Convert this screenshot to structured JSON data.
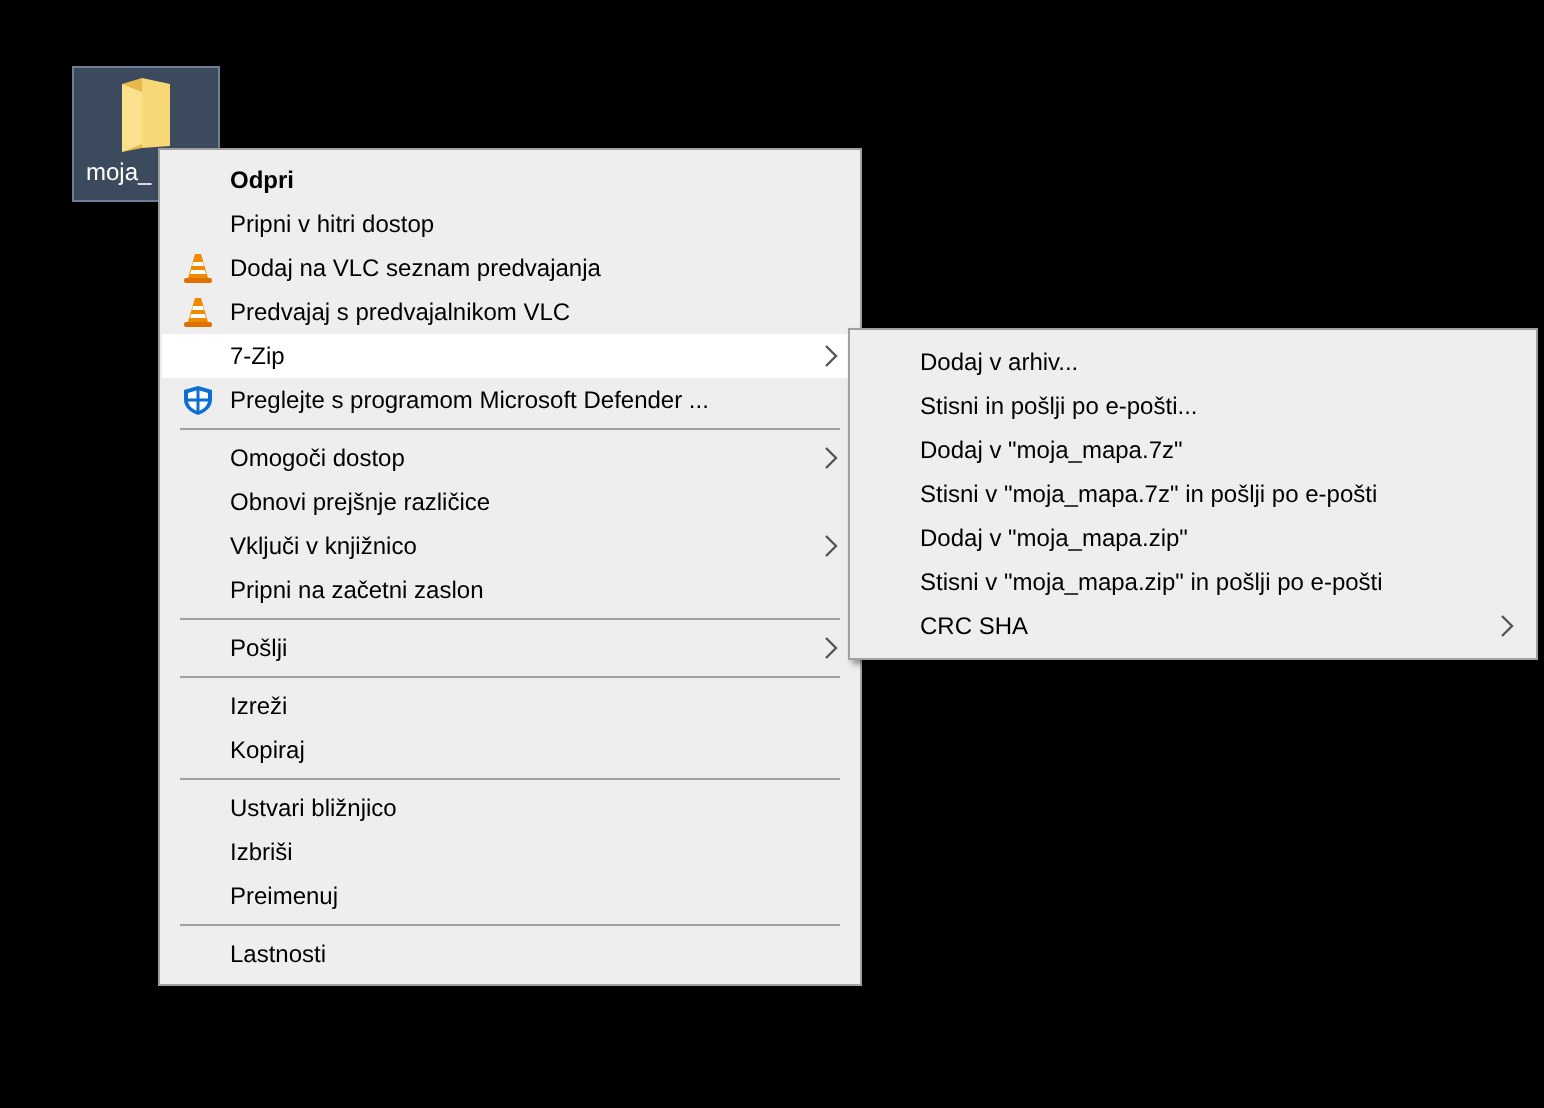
{
  "desktop_icon": {
    "label": "moja_",
    "selected": true
  },
  "context_menu": {
    "items": [
      {
        "kind": "default",
        "label": "Odpri",
        "selected": false
      },
      {
        "kind": "plain",
        "label": "Pripni v hitri dostop",
        "selected": false
      },
      {
        "kind": "vlc",
        "label": "Dodaj na VLC seznam predvajanja",
        "selected": false
      },
      {
        "kind": "vlc",
        "label": "Predvajaj s predvajalnikom VLC",
        "selected": false
      },
      {
        "kind": "submenu",
        "label": "7-Zip",
        "selected": true
      },
      {
        "kind": "defender",
        "label": "Preglejte s programom Microsoft Defender ...",
        "selected": false
      },
      {
        "kind": "separator"
      },
      {
        "kind": "submenu",
        "label": "Omogoči dostop",
        "selected": false
      },
      {
        "kind": "plain",
        "label": "Obnovi prejšnje različice",
        "selected": false
      },
      {
        "kind": "submenu",
        "label": "Vključi v knjižnico",
        "selected": false
      },
      {
        "kind": "plain",
        "label": "Pripni na začetni zaslon",
        "selected": false
      },
      {
        "kind": "separator"
      },
      {
        "kind": "submenu",
        "label": "Pošlji",
        "selected": false
      },
      {
        "kind": "separator"
      },
      {
        "kind": "plain",
        "label": "Izreži",
        "selected": false
      },
      {
        "kind": "plain",
        "label": "Kopiraj",
        "selected": false
      },
      {
        "kind": "separator"
      },
      {
        "kind": "plain",
        "label": "Ustvari bližnjico",
        "selected": false
      },
      {
        "kind": "plain",
        "label": "Izbriši",
        "selected": false
      },
      {
        "kind": "plain",
        "label": "Preimenuj",
        "selected": false
      },
      {
        "kind": "separator"
      },
      {
        "kind": "plain",
        "label": "Lastnosti",
        "selected": false
      }
    ]
  },
  "submenu": {
    "items": [
      {
        "kind": "plain",
        "label": "Dodaj v arhiv...",
        "selected": false
      },
      {
        "kind": "plain",
        "label": "Stisni in pošlji po e-pošti...",
        "selected": false
      },
      {
        "kind": "plain",
        "label": "Dodaj v \"moja_mapa.7z\"",
        "selected": false
      },
      {
        "kind": "plain",
        "label": "Stisni v \"moja_mapa.7z\" in pošlji po e-pošti",
        "selected": false
      },
      {
        "kind": "plain",
        "label": "Dodaj v \"moja_mapa.zip\"",
        "selected": false
      },
      {
        "kind": "plain",
        "label": "Stisni v \"moja_mapa.zip\" in pošlji po e-pošti",
        "selected": false
      },
      {
        "kind": "submenu",
        "label": "CRC SHA",
        "selected": false
      }
    ]
  }
}
